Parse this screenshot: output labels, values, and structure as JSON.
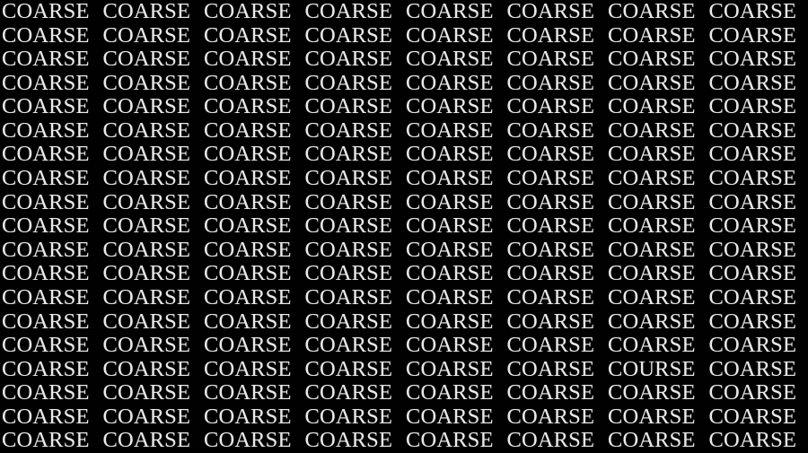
{
  "puzzle": {
    "background_color": "#000000",
    "text_color": "#e9e9e9",
    "rows": 19,
    "columns": 8,
    "common_word": "COARSE",
    "odd_word": "COURSE",
    "odd_word_row": 16,
    "odd_word_column": 7,
    "grid": [
      [
        "COARSE",
        "COARSE",
        "COARSE",
        "COARSE",
        "COARSE",
        "COARSE",
        "COARSE",
        "COARSE"
      ],
      [
        "COARSE",
        "COARSE",
        "COARSE",
        "COARSE",
        "COARSE",
        "COARSE",
        "COARSE",
        "COARSE"
      ],
      [
        "COARSE",
        "COARSE",
        "COARSE",
        "COARSE",
        "COARSE",
        "COARSE",
        "COARSE",
        "COARSE"
      ],
      [
        "COARSE",
        "COARSE",
        "COARSE",
        "COARSE",
        "COARSE",
        "COARSE",
        "COARSE",
        "COARSE"
      ],
      [
        "COARSE",
        "COARSE",
        "COARSE",
        "COARSE",
        "COARSE",
        "COARSE",
        "COARSE",
        "COARSE"
      ],
      [
        "COARSE",
        "COARSE",
        "COARSE",
        "COARSE",
        "COARSE",
        "COARSE",
        "COARSE",
        "COARSE"
      ],
      [
        "COARSE",
        "COARSE",
        "COARSE",
        "COARSE",
        "COARSE",
        "COARSE",
        "COARSE",
        "COARSE"
      ],
      [
        "COARSE",
        "COARSE",
        "COARSE",
        "COARSE",
        "COARSE",
        "COARSE",
        "COARSE",
        "COARSE"
      ],
      [
        "COARSE",
        "COARSE",
        "COARSE",
        "COARSE",
        "COARSE",
        "COARSE",
        "COARSE",
        "COARSE"
      ],
      [
        "COARSE",
        "COARSE",
        "COARSE",
        "COARSE",
        "COARSE",
        "COARSE",
        "COARSE",
        "COARSE"
      ],
      [
        "COARSE",
        "COARSE",
        "COARSE",
        "COARSE",
        "COARSE",
        "COARSE",
        "COARSE",
        "COARSE"
      ],
      [
        "COARSE",
        "COARSE",
        "COARSE",
        "COARSE",
        "COARSE",
        "COARSE",
        "COARSE",
        "COARSE"
      ],
      [
        "COARSE",
        "COARSE",
        "COARSE",
        "COARSE",
        "COARSE",
        "COARSE",
        "COARSE",
        "COARSE"
      ],
      [
        "COARSE",
        "COARSE",
        "COARSE",
        "COARSE",
        "COARSE",
        "COARSE",
        "COARSE",
        "COARSE"
      ],
      [
        "COARSE",
        "COARSE",
        "COARSE",
        "COARSE",
        "COARSE",
        "COARSE",
        "COARSE",
        "COARSE"
      ],
      [
        "COARSE",
        "COARSE",
        "COARSE",
        "COARSE",
        "COARSE",
        "COARSE",
        "COURSE",
        "COARSE"
      ],
      [
        "COARSE",
        "COARSE",
        "COARSE",
        "COARSE",
        "COARSE",
        "COARSE",
        "COARSE",
        "COARSE"
      ],
      [
        "COARSE",
        "COARSE",
        "COARSE",
        "COARSE",
        "COARSE",
        "COARSE",
        "COARSE",
        "COARSE"
      ],
      [
        "COARSE",
        "COARSE",
        "COARSE",
        "COARSE",
        "COARSE",
        "COARSE",
        "COARSE",
        "COARSE"
      ]
    ]
  }
}
